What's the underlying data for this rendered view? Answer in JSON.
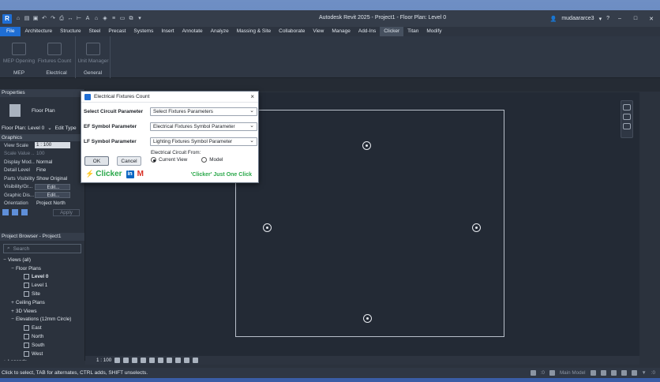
{
  "app": {
    "logo_letter": "R",
    "window_title": "Autodesk Revit 2025 - Project1 - Floor Plan: Level 0",
    "user": "mudaararce3",
    "help": "?",
    "min": "–",
    "max": "□",
    "close": "✕"
  },
  "menu": [
    "File",
    "Architecture",
    "Structure",
    "Steel",
    "Precast",
    "Systems",
    "Insert",
    "Annotate",
    "Analyze",
    "Massing & Site",
    "Collaborate",
    "View",
    "Manage",
    "Add-Ins",
    "Clicker",
    "Titan",
    "Modify"
  ],
  "menu_active": "Clicker",
  "ribbon": {
    "panels": [
      {
        "label": "MEP",
        "buttons": [
          "MEP Opening"
        ]
      },
      {
        "label": "Electrical",
        "buttons": [
          "Fixtures Count"
        ]
      },
      {
        "label": "General",
        "buttons": [
          "Unit Manager"
        ]
      }
    ]
  },
  "properties": {
    "header": "Properties",
    "type_name": "Floor Plan",
    "selector": "Floor Plan: Level 0",
    "edit_type": "Edit Type",
    "group": "Graphics",
    "rows": [
      {
        "k": "View Scale",
        "v": "1 : 100",
        "style": "box"
      },
      {
        "k": "Scale Value ...",
        "v": "100",
        "style": "dim"
      },
      {
        "k": "Display Mod...",
        "v": "Normal",
        "style": ""
      },
      {
        "k": "Detail Level",
        "v": "Fine",
        "style": ""
      },
      {
        "k": "Parts Visibility",
        "v": "Show Original",
        "style": ""
      },
      {
        "k": "Visibility/Gr...",
        "v": "Edit...",
        "style": "btn"
      },
      {
        "k": "Graphic Dis...",
        "v": "Edit...",
        "style": "btn"
      },
      {
        "k": "Orientation",
        "v": "Project North",
        "style": ""
      }
    ],
    "apply": "Apply"
  },
  "browser": {
    "header": "Project Browser - Project1",
    "search_placeholder": "Search",
    "items": [
      {
        "indent": 0,
        "toggle": "−",
        "label": "Views (all)",
        "icon": false,
        "bold": false
      },
      {
        "indent": 1,
        "toggle": "−",
        "label": "Floor Plans",
        "icon": false,
        "bold": false
      },
      {
        "indent": 2,
        "toggle": "",
        "label": "Level 0",
        "icon": true,
        "bold": true
      },
      {
        "indent": 2,
        "toggle": "",
        "label": "Level 1",
        "icon": true,
        "bold": false
      },
      {
        "indent": 2,
        "toggle": "",
        "label": "Site",
        "icon": true,
        "bold": false
      },
      {
        "indent": 1,
        "toggle": "+",
        "label": "Ceiling Plans",
        "icon": false,
        "bold": false
      },
      {
        "indent": 1,
        "toggle": "+",
        "label": "3D Views",
        "icon": false,
        "bold": false
      },
      {
        "indent": 1,
        "toggle": "−",
        "label": "Elevations (12mm Circle)",
        "icon": false,
        "bold": false
      },
      {
        "indent": 2,
        "toggle": "",
        "label": "East",
        "icon": true,
        "bold": false
      },
      {
        "indent": 2,
        "toggle": "",
        "label": "North",
        "icon": true,
        "bold": false
      },
      {
        "indent": 2,
        "toggle": "",
        "label": "South",
        "icon": true,
        "bold": false
      },
      {
        "indent": 2,
        "toggle": "",
        "label": "West",
        "icon": true,
        "bold": false
      },
      {
        "indent": 0,
        "toggle": "+",
        "label": "Legends",
        "icon": false,
        "bold": false
      }
    ]
  },
  "view_control": {
    "scale": "1 : 100"
  },
  "status": {
    "text": "Click to select, TAB for alternates, CTRL adds, SHIFT unselects.",
    "zero": ":0",
    "model": "Main Model",
    "filter": ":0"
  },
  "dialog": {
    "title": "Electrical Fixtures Count",
    "close": "×",
    "fields": [
      {
        "label": "Select Circuit Parameter",
        "value": "Select Fixtures Parameters"
      },
      {
        "label": "EF Symbol Parameter",
        "value": "Electrical Fixtures Symbol Parameter"
      },
      {
        "label": "LF Symbol Parameter",
        "value": "Lighting Fixtures Symbol Parameter"
      }
    ],
    "circuit_from_label": "Electrical Circuit From:",
    "option_current": "Current View",
    "option_model": "Model",
    "ok": "OK",
    "cancel": "Cancel",
    "brand_name": "Clicker",
    "linkedin": "in",
    "gmail": "M",
    "slogan": "'Clicker' Just One Click"
  }
}
